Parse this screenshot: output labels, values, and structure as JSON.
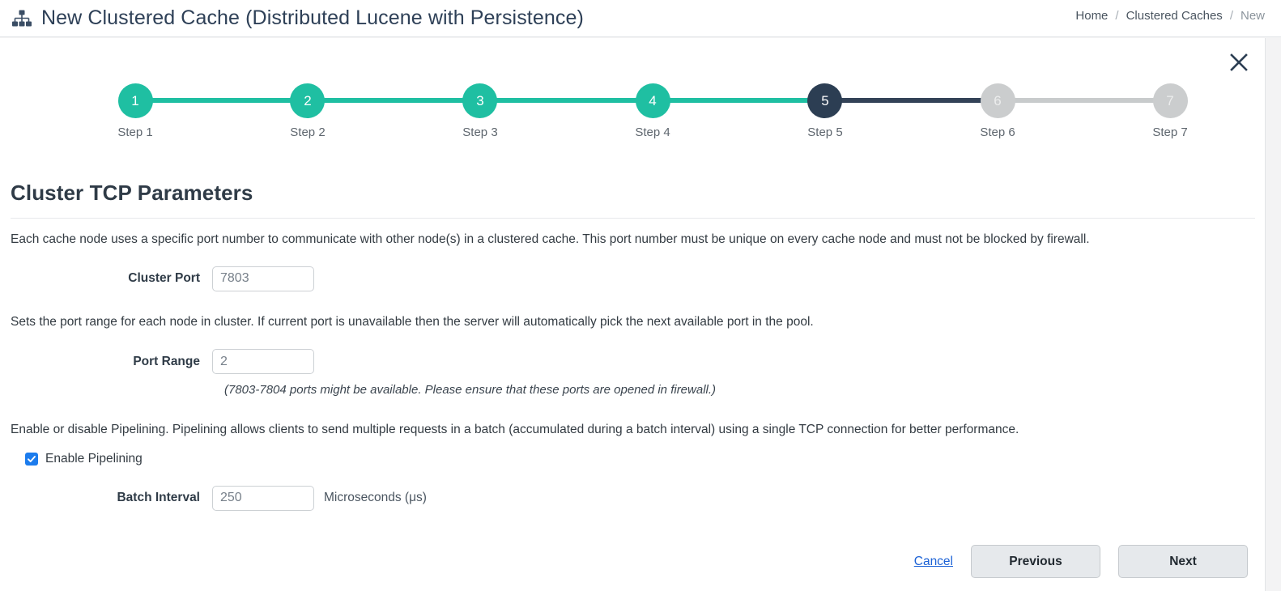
{
  "header": {
    "icon": "sitemap-icon",
    "title": "New Clustered Cache (Distributed Lucene with Persistence)",
    "breadcrumb": {
      "home": "Home",
      "sep1": "/",
      "section": "Clustered Caches",
      "sep2": "/",
      "current": "New"
    },
    "close_icon": "close-icon"
  },
  "stepper": {
    "steps": [
      {
        "number": "1",
        "label": "Step 1",
        "state": "done"
      },
      {
        "number": "2",
        "label": "Step 2",
        "state": "done"
      },
      {
        "number": "3",
        "label": "Step 3",
        "state": "done"
      },
      {
        "number": "4",
        "label": "Step 4",
        "state": "done"
      },
      {
        "number": "5",
        "label": "Step 5",
        "state": "current"
      },
      {
        "number": "6",
        "label": "Step 6",
        "state": "todo"
      },
      {
        "number": "7",
        "label": "Step 7",
        "state": "todo"
      }
    ],
    "colors": {
      "done": "#1fbfa2",
      "current": "#2c3e53",
      "todo": "#cbcdce"
    }
  },
  "section": {
    "heading": "Cluster TCP Parameters"
  },
  "form": {
    "port_description": "Each cache node uses a specific port number to communicate with other node(s) in a clustered cache. This port number must be unique on every cache node and must not be blocked by firewall.",
    "cluster_port": {
      "label": "Cluster Port",
      "value": "7803"
    },
    "range_description": "Sets the port range for each node in cluster. If current port is unavailable then the server will automatically pick the next available port in the pool.",
    "port_range": {
      "label": "Port Range",
      "value": "2",
      "hint": "(7803-7804 ports might be available. Please ensure that these ports are opened in firewall.)"
    },
    "pipelining_description": "Enable or disable Pipelining. Pipelining allows clients to send multiple requests in a batch (accumulated during a batch interval) using a single TCP connection for better performance.",
    "enable_pipelining": {
      "label": "Enable Pipelining",
      "checked": true
    },
    "batch_interval": {
      "label": "Batch Interval",
      "value": "250",
      "unit": "Microseconds (μs)"
    }
  },
  "footer": {
    "cancel": "Cancel",
    "previous": "Previous",
    "next": "Next"
  }
}
